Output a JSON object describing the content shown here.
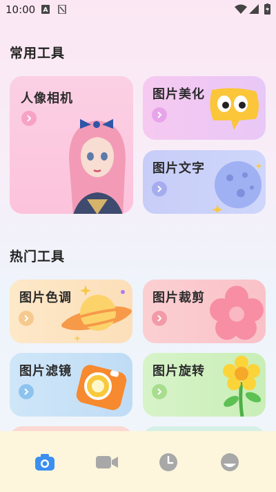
{
  "status_bar": {
    "time": "10:00"
  },
  "common_tools": {
    "title": "常用工具",
    "portrait_camera": "人像相机",
    "photo_beautify": "图片美化",
    "photo_text": "图片文字"
  },
  "hot_tools": {
    "title": "热门工具",
    "photo_tone": "图片色调",
    "photo_crop": "图片裁剪",
    "photo_filter": "图片滤镜",
    "photo_rotate": "图片旋转"
  },
  "bottom_nav": {
    "items": [
      "camera-icon",
      "video-icon",
      "clock-icon",
      "profile-icon"
    ],
    "active": "camera-icon"
  },
  "colors": {
    "accent_blue": "#3c8ef0",
    "nav_bg": "#fdf6dc"
  }
}
